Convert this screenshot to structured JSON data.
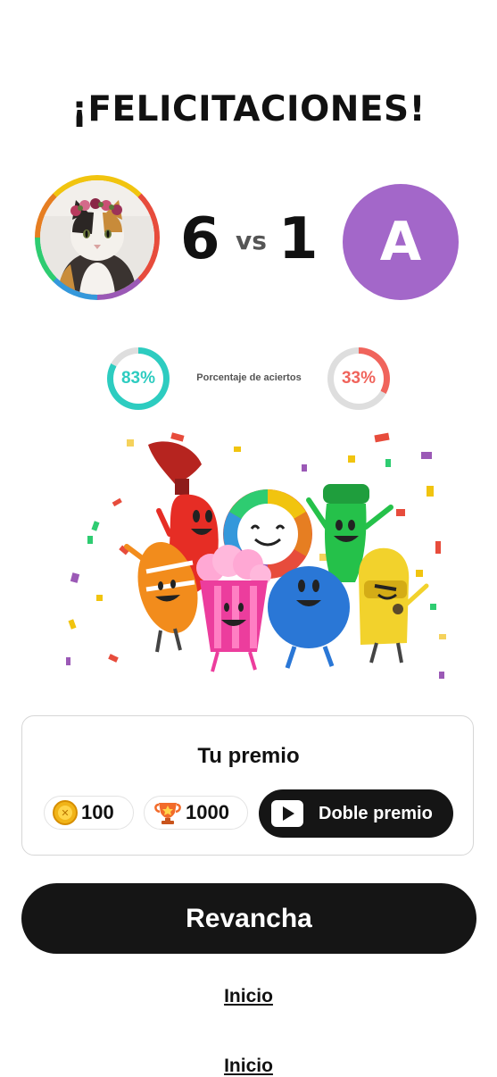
{
  "header": {
    "title": "¡FELICITACIONES!"
  },
  "match": {
    "player_score": "6",
    "vs_label": "vs",
    "opponent_score": "1",
    "opponent_initial": "A",
    "opponent_color": "#a367c9",
    "player_avatar": "cat-with-flower-crown-photo"
  },
  "accuracy": {
    "label": "Porcentaje de aciertos",
    "player_percent": "83%",
    "player_value": 0.83,
    "player_color": "#2dccc0",
    "opponent_percent": "33%",
    "opponent_value": 0.33,
    "opponent_color": "#f0645c",
    "track_color": "#dedede"
  },
  "illustration": {
    "name": "celebrating-characters-with-confetti"
  },
  "prize": {
    "title": "Tu premio",
    "coins_value": "100",
    "coins_icon": "coin-icon",
    "trophies_value": "1000",
    "trophies_icon": "trophy-icon",
    "double_button_label": "Doble premio",
    "double_button_icon": "play-video-icon"
  },
  "actions": {
    "rematch_label": "Revancha",
    "home_label": "Inicio",
    "home_label_repeat": "Inicio"
  }
}
